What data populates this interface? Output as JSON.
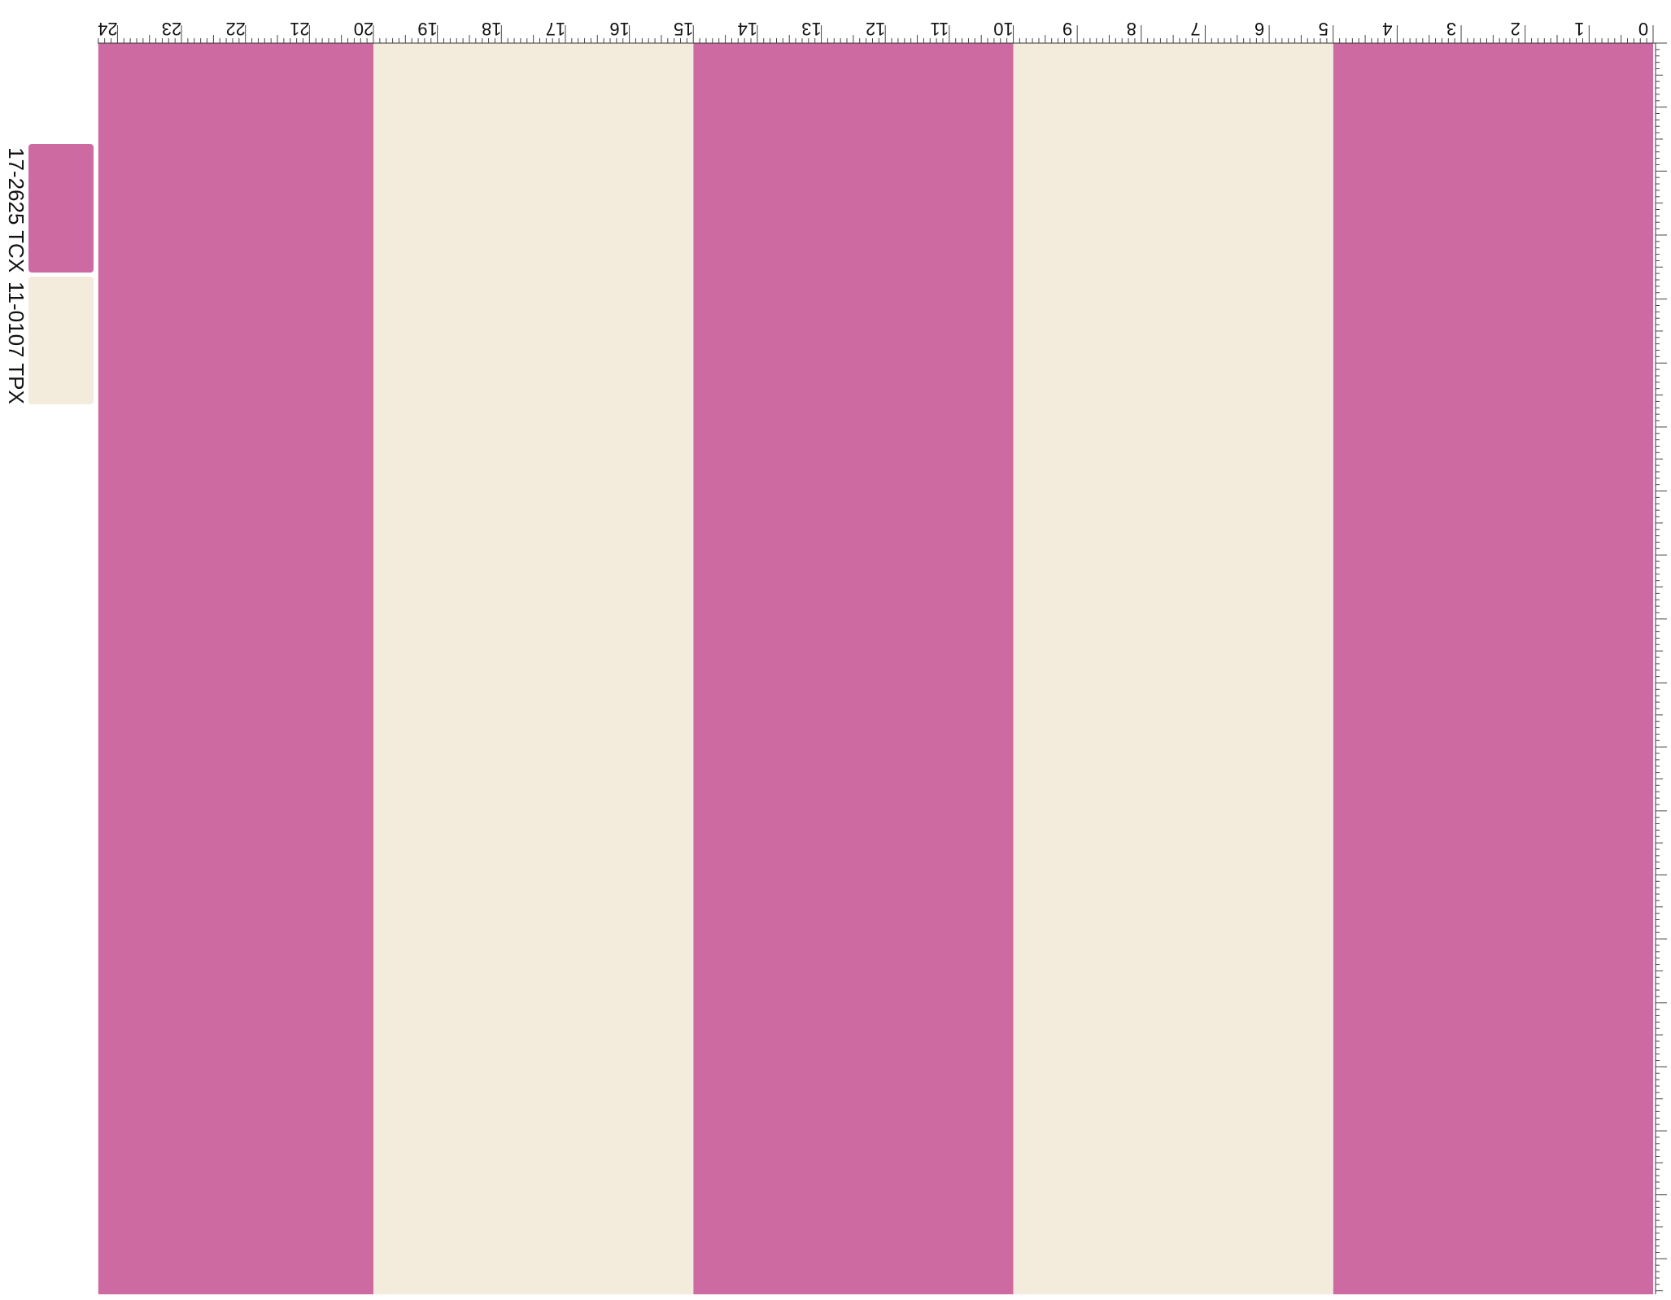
{
  "palette": [
    {
      "label": "17-2625 TCX",
      "color": "#cd6aa1"
    },
    {
      "label": "11-0107 TPX",
      "color": "#f3ecdd"
    }
  ],
  "stripes": [
    {
      "from": 0,
      "to": 5,
      "color": "#cd6aa1"
    },
    {
      "from": 5,
      "to": 10,
      "color": "#f3ecdd"
    },
    {
      "from": 10,
      "to": 15,
      "color": "#cd6aa1"
    },
    {
      "from": 15,
      "to": 20,
      "color": "#f3ecdd"
    },
    {
      "from": 20,
      "to": 24.3,
      "color": "#cd6aa1"
    }
  ],
  "ruler": {
    "labels": [
      "0",
      "1",
      "2",
      "3",
      "4",
      "5",
      "6",
      "7",
      "8",
      "9",
      "10",
      "11",
      "12",
      "13",
      "14",
      "15",
      "16",
      "17",
      "18",
      "19",
      "20",
      "21",
      "22",
      "23",
      "24"
    ],
    "subdivisions": 10
  }
}
